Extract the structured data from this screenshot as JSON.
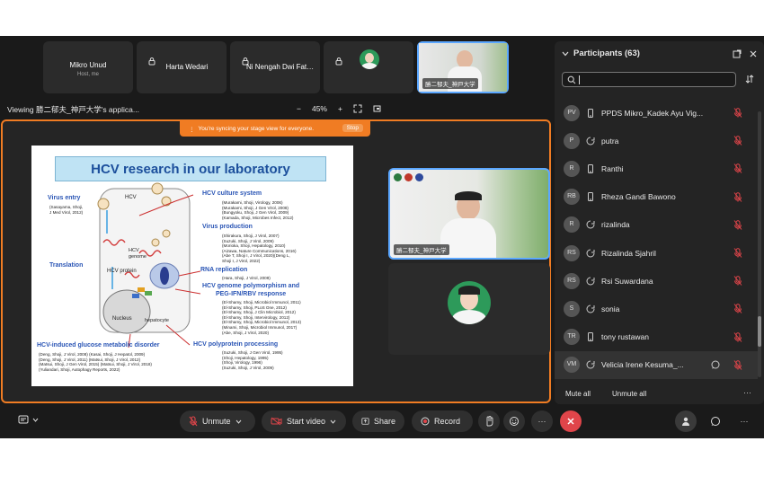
{
  "thumbnails": [
    {
      "name": "Mikro Unud",
      "sub": "Host, me"
    },
    {
      "name": "Harta Wedari"
    },
    {
      "name": "Ni Nengah Dwi Fatmaw..."
    },
    {
      "name": ""
    },
    {
      "name": "勝二郁夫_神戸大学"
    }
  ],
  "viewing": {
    "label": "Viewing 勝二郁夫_神戸大学's applica...",
    "zoom_minus": "−",
    "zoom": "45%",
    "zoom_plus": "+"
  },
  "sync_banner": {
    "text": "You're syncing your stage view for everyone.",
    "stop": "Stop"
  },
  "slide": {
    "title": "HCV research in our laboratory",
    "virus_entry": "Virus entry",
    "virus_entry_ref": "(Sasayama, Shoji,\nJ Med Virol, 2012)",
    "hcv": "HCV",
    "hcv_genome": "HCV\ngenome",
    "translation": "Translation",
    "hcv_protein": "HCV protein",
    "nucleus": "Nucleus",
    "hepatocyte": "hepatocyte",
    "culture_system": "HCV culture system",
    "culture_refs": "(Murakami, Shoji, Virology, 2006)\n(Murakami, Shoji, J Gen Virol, 2008)\n(Bungyoku, Shoji, J Gen Virol, 2009)\n(Kamada, Shoji, Microbes Infect, 2012)",
    "virus_production": "Virus production",
    "production_refs": "(Shirakura, Shoji, J Virol, 2007)\n(Suzuki, Shoji, J Virol, 2009)\n(Morioka, Shoji, Hepatology, 2010)\n(Aizawa, Nature Communications, 2016)\n(Abe T, Shoji I, J Virol, 2020)(Deng L,\nShoji I, J Virol, 2022)",
    "rna_replication": "RNA replication",
    "replication_refs": "(Hara, Shoji, J Virol, 2009)",
    "polymorphism": "HCV genome polymorphism and\nPEG-IFN/RBV response",
    "polymorphism_refs": "(El-Shamy, Shoji, Microbiol Immunol, 2011)\n(El-Shamy, Shoji, PLoS One, 2012)\n(El-Shamy, Shoji, J Clin Microbiol, 2012)\n(El-Shamy, Shoji, Intervirology, 2012)\n(El-Shamy, Shoji, Microbiol Immunol, 2013)\n(Minami, Shoji, Microbiol Immunol, 2017)\n(Abe, Shoji, J Virol, 2020)",
    "glucose": "HCV-induced glucose metabolic disorder",
    "glucose_refs": "(Deng, Shoji, J Virol, 2008) (Kasai, Shoji, J Hepatol, 2009)\n(Deng, Shoji, J Virol, 2011) (Matsui, Shoji, J Virol, 2012)\n(Matsui, Shoji, J Gen Virol, 2015) (Matsui, Shoji, J Virol, 2018)\n(Yuliandari, Shoji, Autophagy Reports, 2022)",
    "polyprotein": "HCV polyprotein processing",
    "polyprotein_refs": "(Suzuki, Shoji, J Gen Virol, 1995)\n(Shoji, Hepatology, 1995)\n(Shoji, Virology, 1996)\n(Suzuki, Shoji, J Virol, 2009)"
  },
  "videos": [
    {
      "name": "勝二郁夫_神戸大学"
    },
    {
      "name": ""
    }
  ],
  "participants": {
    "title": "Participants (63)",
    "items": [
      {
        "initials": "PV",
        "name": "PPDS Mikro_Kadek Ayu Vig...",
        "device": "phone",
        "chat": false
      },
      {
        "initials": "P",
        "name": "putra",
        "device": "web",
        "chat": false
      },
      {
        "initials": "R",
        "name": "Ranthi",
        "device": "phone",
        "chat": false
      },
      {
        "initials": "RB",
        "name": "Rheza Gandi Bawono",
        "device": "phone",
        "chat": false
      },
      {
        "initials": "R",
        "name": "rizalinda",
        "device": "web",
        "chat": false
      },
      {
        "initials": "RS",
        "name": "Rizalinda Sjahril",
        "device": "web",
        "chat": false
      },
      {
        "initials": "RS",
        "name": "Rsi Suwardana",
        "device": "web",
        "chat": false
      },
      {
        "initials": "S",
        "name": "sonia",
        "device": "web",
        "chat": false
      },
      {
        "initials": "TR",
        "name": "tony rustawan",
        "device": "phone",
        "chat": false
      },
      {
        "initials": "VM",
        "name": "Velicia Irene Kesuma_...",
        "device": "web",
        "chat": true
      }
    ],
    "mute_all": "Mute all",
    "unmute_all": "Unmute all"
  },
  "toolbar": {
    "unmute": "Unmute",
    "start_video": "Start video",
    "share": "Share",
    "record": "Record"
  },
  "colors": {
    "accent": "#f07c23",
    "highlight": "#5ba7ff",
    "mic_muted": "#e0454a"
  }
}
